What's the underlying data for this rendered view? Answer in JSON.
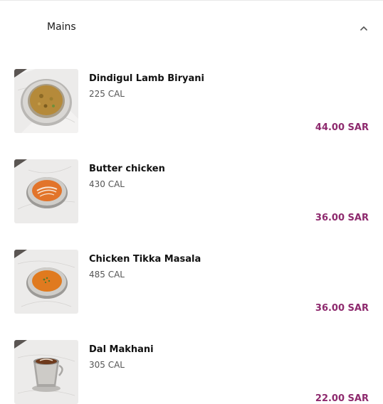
{
  "section": {
    "title": "Mains",
    "icon": "chevron-up-icon"
  },
  "colors": {
    "price": "#8e2a6e",
    "text": "#111111",
    "muted": "#555555"
  },
  "items": [
    {
      "name": "Dindigul Lamb Biryani",
      "calories": "225 CAL",
      "price": "44.00 SAR",
      "image": "biryani-bowl-image"
    },
    {
      "name": "Butter chicken",
      "calories": "430 CAL",
      "price": "36.00 SAR",
      "image": "butter-chicken-bowl-image"
    },
    {
      "name": "Chicken Tikka Masala",
      "calories": "485 CAL",
      "price": "36.00 SAR",
      "image": "tikka-masala-bowl-image"
    },
    {
      "name": "Dal Makhani",
      "calories": "305 CAL",
      "price": "22.00 SAR",
      "image": "dal-makhani-cup-image"
    }
  ]
}
